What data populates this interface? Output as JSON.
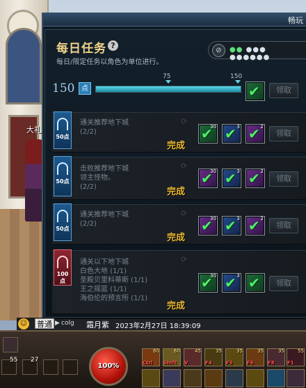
{
  "window": {
    "title": "畅玩"
  },
  "world": {
    "npc_name_partial": "大礼"
  },
  "panel": {
    "title": "每日任务",
    "subtitle": "每日/限定任务以角色为单位进行。",
    "secret_field": {
      "status": "●●",
      "masked": "●●● ●●●●●●"
    },
    "points": "150",
    "points_icon": "点",
    "milestone_1": "75",
    "milestone_2": "150",
    "progress_fraction": 1.0,
    "milestone_claim_label": "领取"
  },
  "quests": [
    {
      "title": "通关推荐地下城",
      "lines": [
        "(2/2)"
      ],
      "points": "50点",
      "status": "完成",
      "claim_label": "领取",
      "tag_color": "blue",
      "rewards": [
        {
          "color": "g",
          "count": "30"
        },
        {
          "color": "b",
          "count": "3"
        },
        {
          "color": "p",
          "count": "2"
        }
      ]
    },
    {
      "title": "击败推荐地下城",
      "lines": [
        "领主怪物。",
        "(2/2)"
      ],
      "points": "50点",
      "status": "完成",
      "claim_label": "领取",
      "tag_color": "blue",
      "rewards": [
        {
          "color": "p",
          "count": "30"
        },
        {
          "color": "b",
          "count": "3"
        },
        {
          "color": "p",
          "count": "2"
        }
      ]
    },
    {
      "title": "通关推荐地下城",
      "lines": [
        "(2/2)"
      ],
      "points": "50点",
      "status": "完成",
      "claim_label": "领取",
      "tag_color": "blue",
      "rewards": [
        {
          "color": "p",
          "count": "30"
        },
        {
          "color": "b",
          "count": "3"
        },
        {
          "color": "p",
          "count": "2"
        }
      ]
    },
    {
      "title": "通关以下地下城",
      "lines": [
        "白色大地 (1/1)",
        "圣殿贝里科蒂斯 (1/1)",
        "王之摇篮 (1/1)",
        "海伯伦的预言所 (1/1)"
      ],
      "points": "100点",
      "status": "完成",
      "claim_label": "领取",
      "tag_color": "red",
      "rewards": [
        {
          "color": "g",
          "count": "30"
        },
        {
          "color": "b",
          "count": "3"
        },
        {
          "color": "g",
          "count": ""
        }
      ]
    }
  ],
  "chat": {
    "channel": "普通",
    "arrow": "▶",
    "user": "colg",
    "nick": "霜月紫",
    "time": "2023年2月27日 18:39:09"
  },
  "hud": {
    "hp_label": "100%",
    "level_a": "55",
    "level_b": "27",
    "skills": [
      {
        "key": "Ctrl",
        "lv": "60"
      },
      {
        "key": "Shift",
        "lv": "60"
      },
      {
        "key": "V",
        "lv": "45"
      },
      {
        "key": "F4",
        "lv": "35"
      },
      {
        "key": "F5",
        "lv": "35"
      },
      {
        "key": "F6",
        "lv": "35"
      },
      {
        "key": "F8",
        "lv": "35"
      },
      {
        "key": "F1",
        "lv": "55"
      }
    ]
  }
}
